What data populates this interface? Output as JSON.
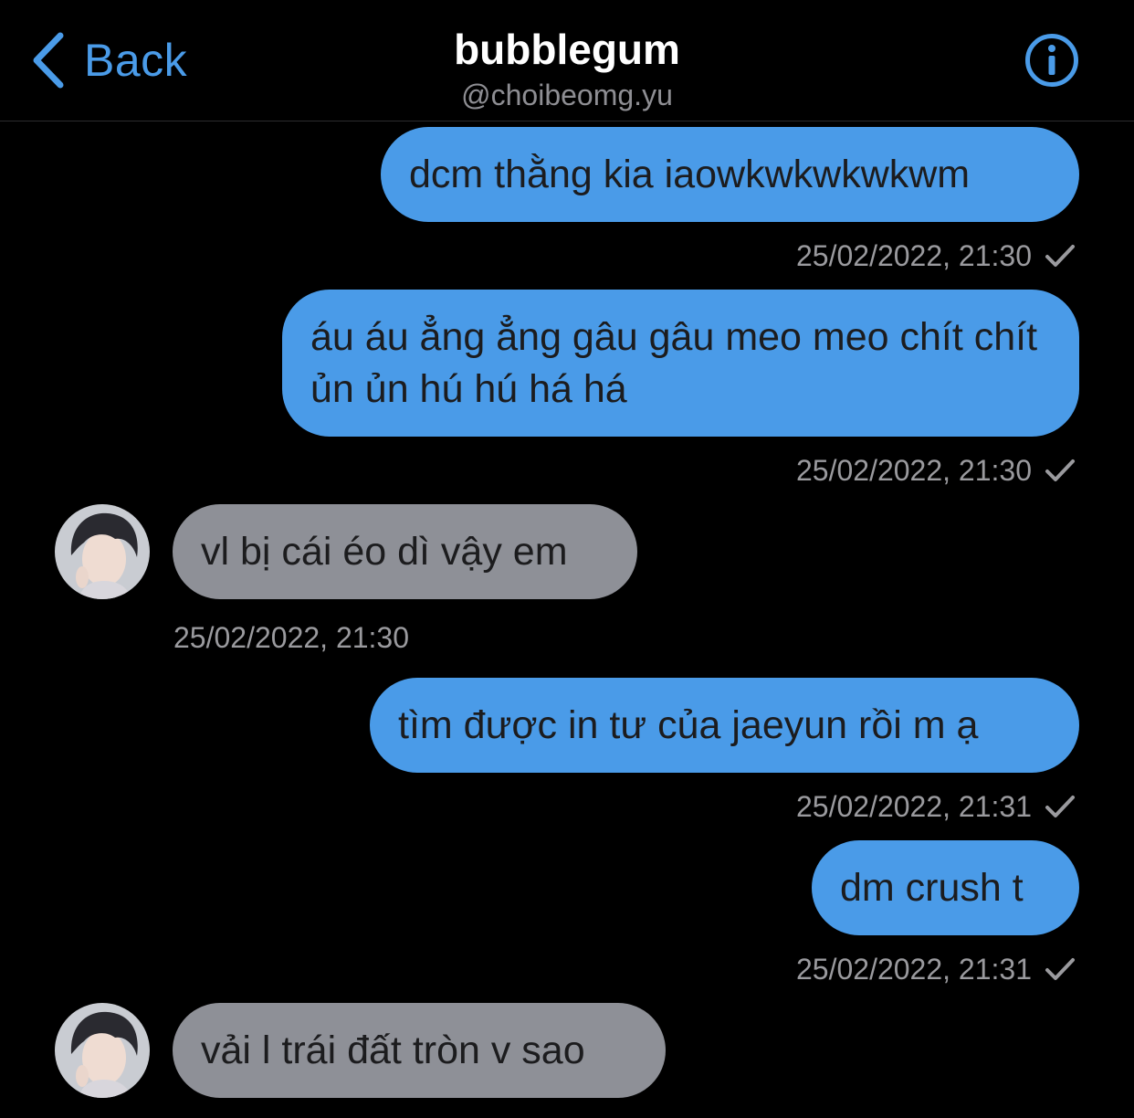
{
  "header": {
    "back_label": "Back",
    "contact_name": "bubblegum",
    "contact_handle": "@choibeomg.yu",
    "back_icon": "chevron-left-icon",
    "info_icon": "info-circle-icon"
  },
  "colors": {
    "accent": "#4a9be8",
    "outgoing_bubble": "#4a9be8",
    "incoming_bubble": "#8e9097",
    "background": "#000000",
    "timestamp": "#9a9a9e"
  },
  "messages": [
    {
      "direction": "outgoing",
      "text": "dcm thằng kia iaowkwkwkwkwm",
      "timestamp": "25/02/2022, 21:30",
      "status_icon": "checkmark-icon"
    },
    {
      "direction": "outgoing",
      "text": "áu áu ẳng ẳng gâu gâu meo meo chít chít ủn ủn hú hú há há",
      "timestamp": "25/02/2022, 21:30",
      "status_icon": "checkmark-icon"
    },
    {
      "direction": "incoming",
      "text": "vl bị cái éo dì vậy em",
      "timestamp": "25/02/2022, 21:30"
    },
    {
      "direction": "outgoing",
      "text": "tìm được in tư của jaeyun rồi m ạ",
      "timestamp": "25/02/2022, 21:31",
      "status_icon": "checkmark-icon"
    },
    {
      "direction": "outgoing",
      "text": "dm crush t",
      "timestamp": "25/02/2022, 21:31",
      "status_icon": "checkmark-icon"
    },
    {
      "direction": "incoming",
      "text": "vải l trái đất tròn v sao"
    }
  ]
}
